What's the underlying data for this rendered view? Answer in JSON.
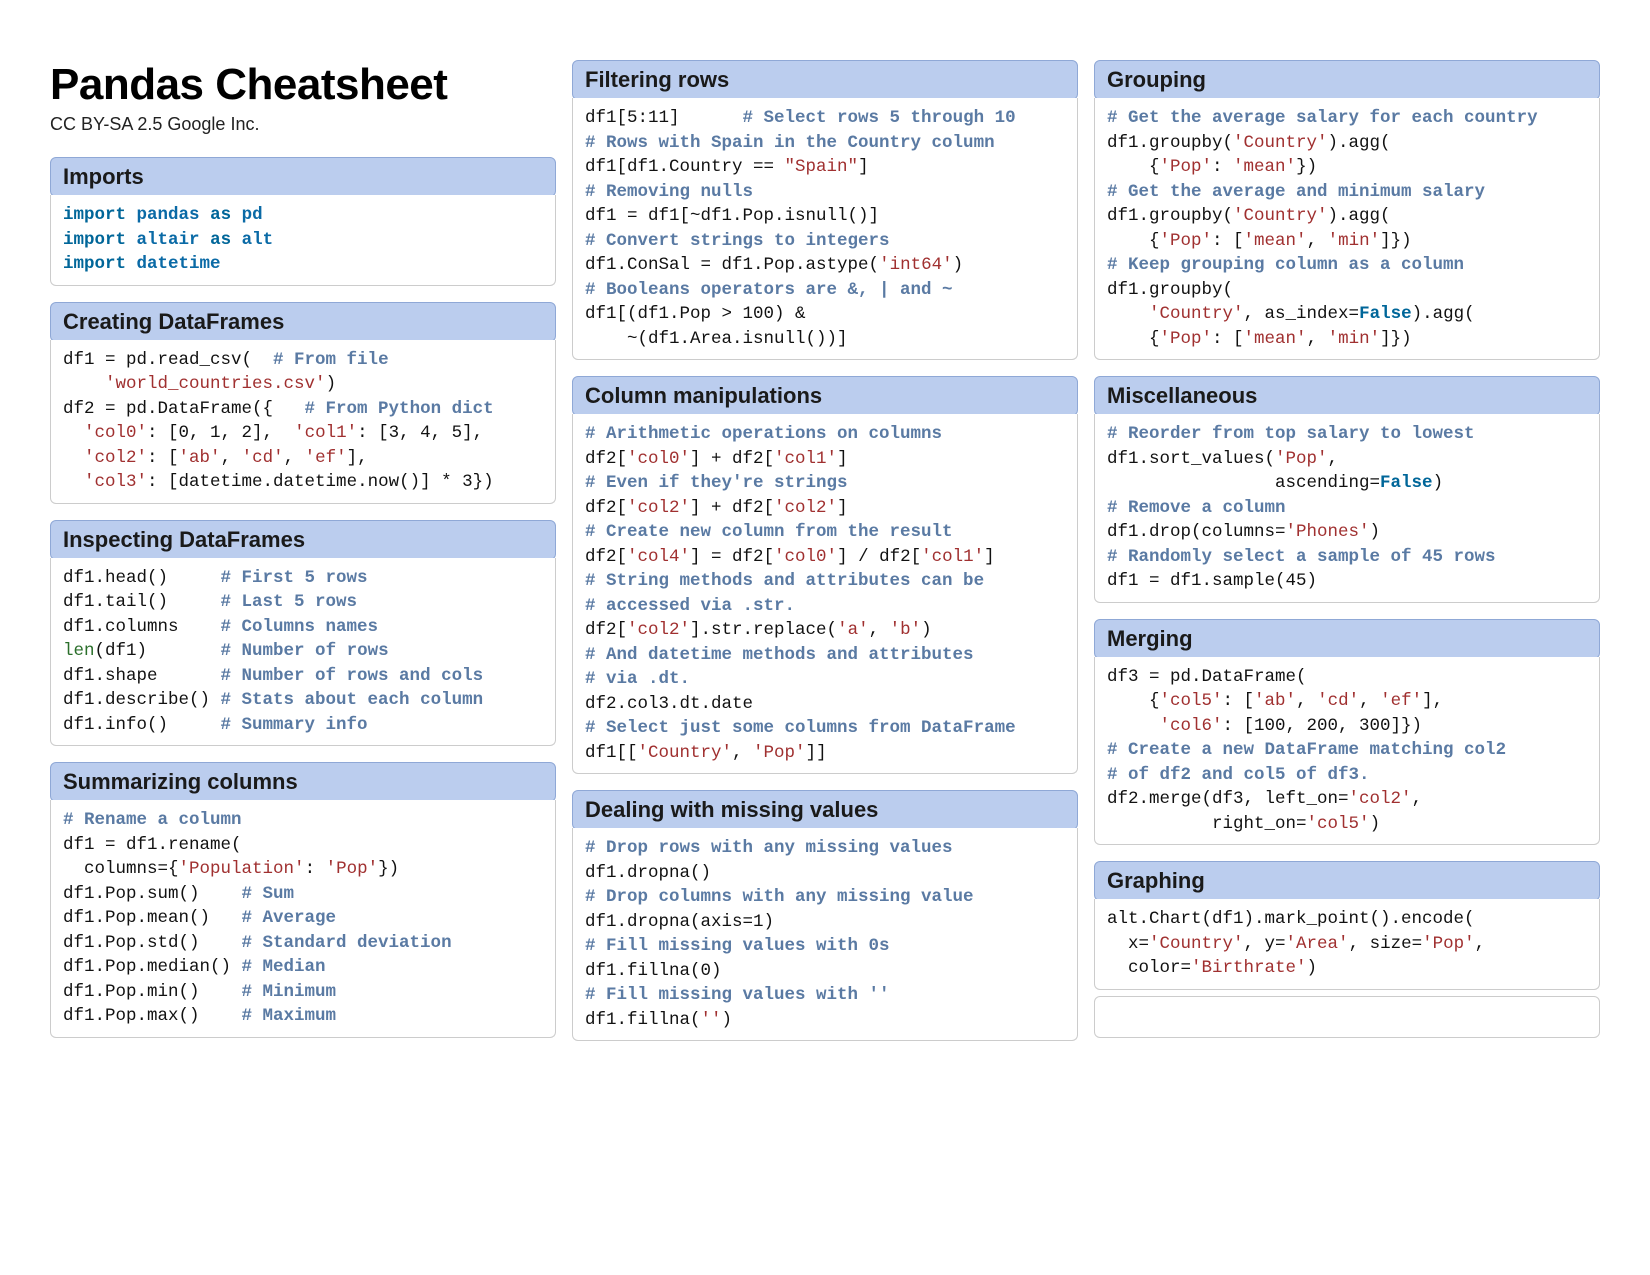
{
  "title": "Pandas Cheatsheet",
  "subtitle": "CC BY-SA 2.5 Google Inc.",
  "col1": {
    "imports": {
      "header": "Imports",
      "kw_import": "import",
      "kw_as": "as",
      "mod_pandas": "pandas",
      "alias_pd": "pd",
      "mod_altair": "altair",
      "alias_alt": "alt",
      "mod_datetime": "datetime"
    },
    "creating": {
      "header": "Creating DataFrames",
      "l1a": "df1 = pd.read_csv(  ",
      "l1c": "# From file",
      "l2a": "    ",
      "l2s": "'world_countries.csv'",
      "l2b": ")",
      "l3a": "df2 = pd.DataFrame({   ",
      "l3c": "# From Python dict",
      "l4a": "  ",
      "l4s1": "'col0'",
      "l4b": ": [0, 1, 2],  ",
      "l4s2": "'col1'",
      "l4c": ": [3, 4, 5],",
      "l5a": "  ",
      "l5s1": "'col2'",
      "l5b": ": [",
      "l5s2": "'ab'",
      "l5c": ", ",
      "l5s3": "'cd'",
      "l5d": ", ",
      "l5s4": "'ef'",
      "l5e": "],",
      "l6a": "  ",
      "l6s1": "'col3'",
      "l6b": ": [datetime.datetime.now()] * 3})"
    },
    "inspecting": {
      "header": "Inspecting DataFrames",
      "l1a": "df1.head()     ",
      "l1c": "# First 5 rows",
      "l2a": "df1.tail()     ",
      "l2c": "# Last 5 rows",
      "l3a": "df1.columns    ",
      "l3c": "# Columns names",
      "l4fn": "len",
      "l4a": "(df1)       ",
      "l4c": "# Number of rows",
      "l5a": "df1.shape      ",
      "l5c": "# Number of rows and cols",
      "l6a": "df1.describe() ",
      "l6c": "# Stats about each column",
      "l7a": "df1.info()     ",
      "l7c": "# Summary info"
    },
    "summarizing": {
      "header": "Summarizing columns",
      "l1c": "# Rename a column",
      "l2": "df1 = df1.rename(",
      "l3a": "  columns={",
      "l3s1": "'Population'",
      "l3b": ": ",
      "l3s2": "'Pop'",
      "l3c": "})",
      "l4a": "df1.Pop.sum()    ",
      "l4c": "# Sum",
      "l5a": "df1.Pop.mean()   ",
      "l5c": "# Average",
      "l6a": "df1.Pop.std()    ",
      "l6c": "# Standard deviation",
      "l7a": "df1.Pop.median() ",
      "l7c": "# Median",
      "l8a": "df1.Pop.min()    ",
      "l8c": "# Minimum",
      "l9a": "df1.Pop.max()    ",
      "l9c": "# Maximum"
    }
  },
  "col2": {
    "filtering": {
      "header": "Filtering rows",
      "l1a": "df1[5:11]      ",
      "l1c": "# Select rows 5 through 10",
      "l2c": "# Rows with Spain in the Country column",
      "l3a": "df1[df1.Country == ",
      "l3s": "\"Spain\"",
      "l3b": "]",
      "l4c": "# Removing nulls",
      "l5": "df1 = df1[~df1.Pop.isnull()]",
      "l6c": "# Convert strings to integers",
      "l7a": "df1.ConSal = df1.Pop.astype(",
      "l7s": "'int64'",
      "l7b": ")",
      "l8c": "# Booleans operators are &, | and ~",
      "l9": "df1[(df1.Pop > 100) &",
      "l10": "    ~(df1.Area.isnull())]"
    },
    "colmanip": {
      "header": "Column manipulations",
      "l1c": "# Arithmetic operations on columns",
      "l2a": "df2[",
      "l2s1": "'col0'",
      "l2b": "] + df2[",
      "l2s2": "'col1'",
      "l2c": "]",
      "l3c": "# Even if they're strings",
      "l4a": "df2[",
      "l4s1": "'col2'",
      "l4b": "] + df2[",
      "l4s2": "'col2'",
      "l4c": "]",
      "l5c": "# Create new column from the result",
      "l6a": "df2[",
      "l6s1": "'col4'",
      "l6b": "] = df2[",
      "l6s2": "'col0'",
      "l6c": "] / df2[",
      "l6s3": "'col1'",
      "l6d": "]",
      "l7c": "# String methods and attributes can be",
      "l8c": "# accessed via .str.",
      "l9a": "df2[",
      "l9s1": "'col2'",
      "l9b": "].str.replace(",
      "l9s2": "'a'",
      "l9c": ", ",
      "l9s3": "'b'",
      "l9d": ")",
      "l10c": "# And datetime methods and attributes",
      "l11c": "# via .dt.",
      "l12": "df2.col3.dt.date",
      "l13c": "# Select just some columns from DataFrame",
      "l14a": "df1[[",
      "l14s1": "'Country'",
      "l14b": ", ",
      "l14s2": "'Pop'",
      "l14c": "]]"
    },
    "missing": {
      "header": "Dealing with missing values",
      "l1c": "# Drop rows with any missing values",
      "l2": "df1.dropna()",
      "l3c": "# Drop columns with any missing value",
      "l4": "df1.dropna(axis=1)",
      "l5c": "# Fill missing values with 0s",
      "l6": "df1.fillna(0)",
      "l7c": "# Fill missing values with ''",
      "l8a": "df1.fillna(",
      "l8s": "''",
      "l8b": ")"
    }
  },
  "col3": {
    "grouping": {
      "header": "Grouping",
      "l1c": "# Get the average salary for each country",
      "l2a": "df1.groupby(",
      "l2s": "'Country'",
      "l2b": ").agg(",
      "l3a": "    {",
      "l3s1": "'Pop'",
      "l3b": ": ",
      "l3s2": "'mean'",
      "l3c": "})",
      "l4c": "# Get the average and minimum salary",
      "l5a": "df1.groupby(",
      "l5s": "'Country'",
      "l5b": ").agg(",
      "l6a": "    {",
      "l6s1": "'Pop'",
      "l6b": ": [",
      "l6s2": "'mean'",
      "l6c": ", ",
      "l6s3": "'min'",
      "l6d": "]})",
      "l7c": "# Keep grouping column as a column",
      "l8": "df1.groupby(",
      "l9a": "    ",
      "l9s": "'Country'",
      "l9b": ", as_index=",
      "l9k": "False",
      "l9c": ").agg(",
      "l10a": "    {",
      "l10s1": "'Pop'",
      "l10b": ": [",
      "l10s2": "'mean'",
      "l10c": ", ",
      "l10s3": "'min'",
      "l10d": "]})"
    },
    "misc": {
      "header": "Miscellaneous",
      "l1c": "# Reorder from top salary to lowest",
      "l2a": "df1.sort_values(",
      "l2s": "'Pop'",
      "l2b": ",",
      "l3a": "                ascending=",
      "l3k": "False",
      "l3b": ")",
      "l4c": "# Remove a column",
      "l5a": "df1.drop(columns=",
      "l5s": "'Phones'",
      "l5b": ")",
      "l6c": "# Randomly select a sample of 45 rows",
      "l7": "df1 = df1.sample(45)"
    },
    "merging": {
      "header": "Merging",
      "l1": "df3 = pd.DataFrame(",
      "l2a": "    {",
      "l2s1": "'col5'",
      "l2b": ": [",
      "l2s2": "'ab'",
      "l2c": ", ",
      "l2s3": "'cd'",
      "l2d": ", ",
      "l2s4": "'ef'",
      "l2e": "],",
      "l3a": "     ",
      "l3s1": "'col6'",
      "l3b": ": [100, 200, 300]})",
      "l4c": "# Create a new DataFrame matching col2",
      "l5c": "# of df2 and col5 of df3.",
      "l6a": "df2.merge(df3, left_on=",
      "l6s1": "'col2'",
      "l6b": ",",
      "l7a": "          right_on=",
      "l7s1": "'col5'",
      "l7b": ")"
    },
    "graphing": {
      "header": "Graphing",
      "l1": "alt.Chart(df1).mark_point().encode(",
      "l2a": "  x=",
      "l2s1": "'Country'",
      "l2b": ", y=",
      "l2s2": "'Area'",
      "l2c": ", size=",
      "l2s3": "'Pop'",
      "l2d": ",",
      "l3a": "  color=",
      "l3s1": "'Birthrate'",
      "l3b": ")"
    }
  }
}
